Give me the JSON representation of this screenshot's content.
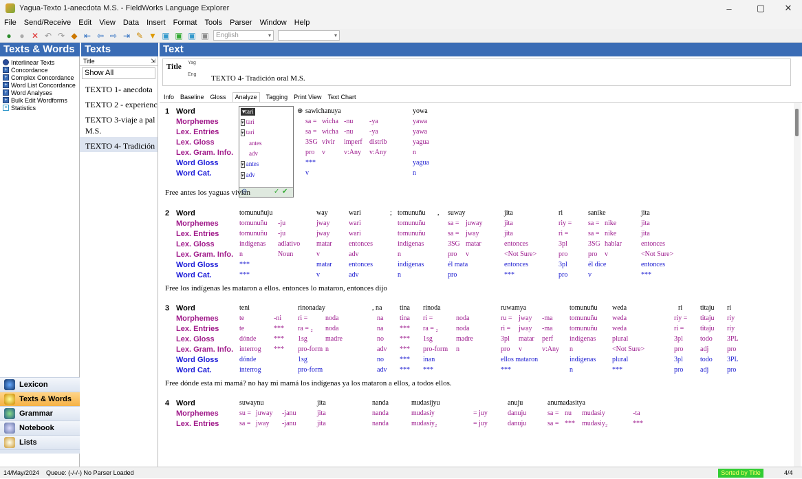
{
  "window": {
    "title": "Yagua-Texto 1-anecdota M.S. - FieldWorks Language Explorer"
  },
  "menu": [
    "File",
    "Send/Receive",
    "Edit",
    "View",
    "Data",
    "Insert",
    "Format",
    "Tools",
    "Parser",
    "Window",
    "Help"
  ],
  "toolbar": {
    "writing_system": "English"
  },
  "panes": {
    "left_header": "Texts & Words",
    "texts_header": "Texts",
    "text_header": "Text"
  },
  "nav_items": [
    "Interlinear Texts",
    "Concordance",
    "Complex Concordance",
    "Word List Concordance",
    "Word Analyses",
    "Bulk Edit Wordforms",
    "Statistics"
  ],
  "areas": [
    "Lexicon",
    "Texts & Words",
    "Grammar",
    "Notebook",
    "Lists"
  ],
  "texts_list": {
    "column": "Title",
    "filter": "Show All",
    "items": [
      "TEXTO 1- anecdota",
      "TEXTO 2 - experienc",
      "TEXTO 3-viaje a pal",
      "M.S.",
      "TEXTO 4- Tradición"
    ]
  },
  "title_box": {
    "label": "Title",
    "ws1": "Yag",
    "ws2": "Eng",
    "value_eng": "TEXTO 4- Tradición oral M.S."
  },
  "tabs": [
    "Info",
    "Baseline",
    "Gloss",
    "Analyze",
    "Tagging",
    "Print View",
    "Text Chart"
  ],
  "line_labels": {
    "word": "Word",
    "morphemes": "Morphemes",
    "lex_entries": "Lex. Entries",
    "lex_gloss": "Lex. Gloss",
    "lex_gram": "Lex. Gram. Info.",
    "word_gloss": "Word Gloss",
    "word_cat": "Word Cat."
  },
  "popup": {
    "items": [
      "tari",
      "tari",
      "tari",
      "antes",
      "adv",
      "antes",
      "adv"
    ]
  },
  "segment1": {
    "num": "1",
    "word": [
      "sawichanuya",
      "yowa"
    ],
    "morphemes": [
      "sa =",
      "wicha",
      "-nu",
      "-ya",
      "yawa"
    ],
    "lex_entries": [
      "sa =",
      "wicha",
      "-nu",
      "-ya",
      "yawa"
    ],
    "lex_gloss": [
      "3SG",
      "vivir",
      "imperf",
      "distrib",
      "yagua"
    ],
    "lex_gram": [
      "pro",
      "v",
      "v:Any",
      "v:Any",
      "n"
    ],
    "word_gloss": [
      "***",
      "yagua"
    ],
    "word_cat": [
      "v",
      "n"
    ],
    "free": "Free antes los yaguas vivian"
  },
  "segment2": {
    "num": "2",
    "word": [
      "tomunuñuju",
      "way",
      "wari",
      ";",
      "tomunuñu",
      ",",
      "suway",
      "jita",
      "ri",
      "sanike",
      "jita"
    ],
    "morphemes": [
      "tomunuñu",
      "-ju",
      "jway",
      "wari",
      "tomunuñu",
      "sa =",
      "juway",
      "jita",
      "riy =",
      "sa =",
      "nike",
      "jita"
    ],
    "lex_entries": [
      "tomunuñu",
      "-ju",
      "jway",
      "wari",
      "tomunuñu",
      "sa =",
      "jway",
      "jita",
      "ri =",
      "sa =",
      "nike",
      "jita"
    ],
    "lex_gloss": [
      "indígenas",
      "adlativo",
      "matar",
      "entonces",
      "indígenas",
      "3SG",
      "matar",
      "entonces",
      "3pl",
      "3SG",
      "hablar",
      "entonces"
    ],
    "lex_gram": [
      "n",
      "Noun",
      "v",
      "adv",
      "n",
      "pro",
      "v",
      "<Not Sure>",
      "pro",
      "pro",
      "v",
      "<Not Sure>"
    ],
    "word_gloss": [
      "***",
      "matar",
      "entonces",
      "indígenas",
      "él mata",
      "entonces",
      "3pl",
      "él dice",
      "entonces"
    ],
    "word_cat": [
      "***",
      "v",
      "adv",
      "n",
      "pro",
      "***",
      "pro",
      "v",
      "***"
    ],
    "free": "Free los indígenas les mataron a ellos. entonces lo mataron, entonces dijo"
  },
  "segment3": {
    "num": "3",
    "word": [
      "teni",
      "rinonaday",
      ", na",
      "tina",
      "rinoda",
      "ruwamya",
      "tomunuñu",
      "weda",
      "ri",
      "titaju",
      "ri"
    ],
    "morphemes": [
      "te",
      "-ni",
      "ri =",
      "noda",
      "na",
      "tina",
      "ri =",
      "noda",
      "ru =",
      "jway",
      "-ma",
      "tomunuñu",
      "weda",
      "riy =",
      "titaju",
      "riy"
    ],
    "lex_entries": [
      "te",
      "***",
      "ra = ₂",
      "noda",
      "na",
      "***",
      "ra = ₂",
      "noda",
      "ri =",
      "jway",
      "-ma",
      "tomunuñu",
      "weda",
      "ri =",
      "titaju",
      "riy"
    ],
    "lex_gloss": [
      "dónde",
      "***",
      "1sg",
      "madre",
      "no",
      "***",
      "1sg",
      "madre",
      "3pl",
      "matar",
      "perf",
      "indígenas",
      "plural",
      "3pl",
      "todo",
      "3PL"
    ],
    "lex_gram": [
      "interrog",
      "***",
      "pro-form",
      "n",
      "adv",
      "***",
      "pro-form",
      "n",
      "pro",
      "v",
      "v:Any",
      "n",
      "<Not Sure>",
      "pro",
      "adj",
      "pro"
    ],
    "word_gloss": [
      "dónde",
      "1sg",
      "no",
      "***",
      "inan",
      "ellos mataron",
      "indígenas",
      "plural",
      "3pl",
      "todo",
      "3PL"
    ],
    "word_cat": [
      "interrog",
      "pro-form",
      "adv",
      "***",
      "***",
      "***",
      "n",
      "***",
      "pro",
      "adj",
      "pro"
    ],
    "free": "Free dónde esta mi mamá? no hay mi mamá los indígenas ya los mataron a ellos, a todos ellos."
  },
  "segment4": {
    "num": "4",
    "word": [
      "suwaynu",
      "jita",
      "nanda",
      "mudasijyu",
      "anuju",
      "anumadasitya"
    ],
    "morphemes": [
      "su =",
      "juway",
      "-janu",
      "jita",
      "nanda",
      "mudasiy",
      "= juy",
      "danuju",
      "sa =",
      "nu",
      "mudasiy",
      "-ta"
    ],
    "lex_entries": [
      "sa =",
      "jway",
      "-janu",
      "jita",
      "nanda",
      "mudasiy₂",
      "= juy",
      "danuju",
      "sa =",
      "***",
      "mudasiy₂",
      "***"
    ]
  },
  "status": {
    "date": "14/May/2024",
    "queue": "Queue: (-/-/-) No Parser Loaded",
    "sorted": "Sorted by Title",
    "count": "4/4"
  },
  "colors": {
    "header_blue": "#3a6cb5",
    "morph_pink": "#9c1a8d",
    "label_blue": "#1b1bd8",
    "status_green": "#33cc33"
  }
}
